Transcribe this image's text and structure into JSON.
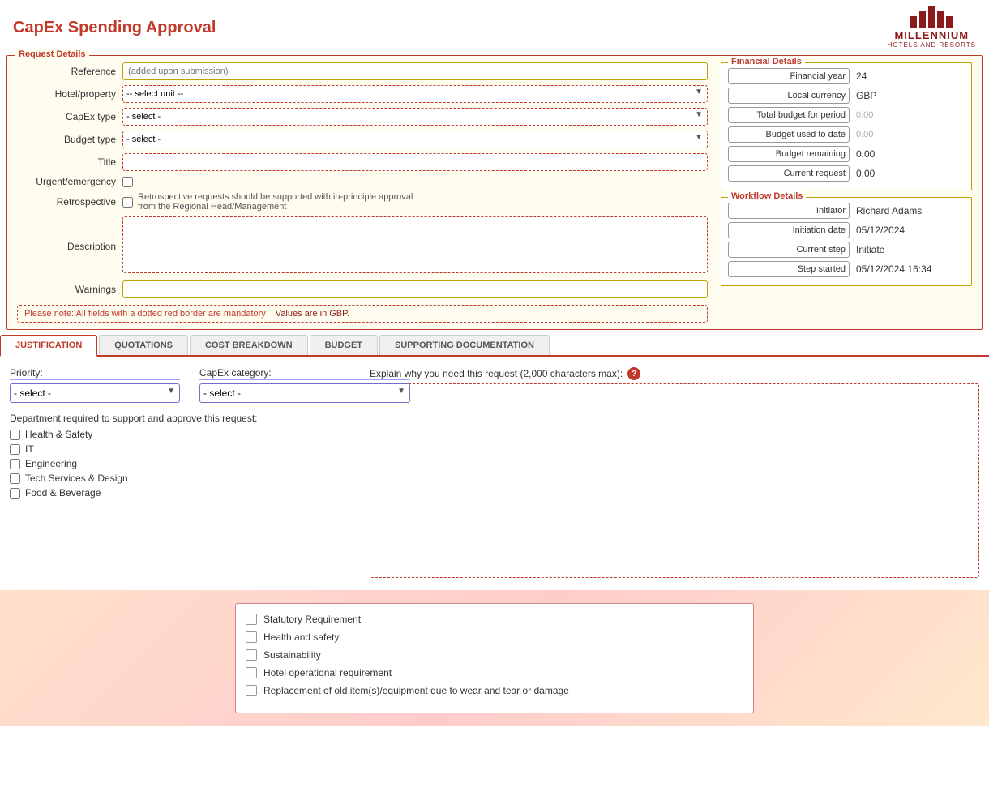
{
  "header": {
    "title": "CapEx Spending Approval",
    "logo_text": "MILLENNIUM",
    "logo_sub": "HOTELS AND RESORTS"
  },
  "request_details": {
    "legend": "Request Details",
    "reference_label": "Reference",
    "reference_placeholder": "(added upon submission)",
    "hotel_property_label": "Hotel/property",
    "hotel_property_placeholder": "-- select unit --",
    "capex_type_label": "CapEx type",
    "capex_type_placeholder": "- select -",
    "budget_type_label": "Budget type",
    "budget_type_placeholder": "- select -",
    "title_label": "Title",
    "urgent_label": "Urgent/emergency",
    "retrospective_label": "Retrospective",
    "retrospective_note": "Retrospective requests should be supported with in-principle approval from the Regional Head/Management",
    "description_label": "Description",
    "warnings_label": "Warnings",
    "notice_mandatory": "Please note: All fields with a dotted red border are mandatory",
    "notice_gbp": "Values are in GBP."
  },
  "financial_details": {
    "legend": "Financial Details",
    "financial_year_label": "Financial year",
    "financial_year_value": "24",
    "local_currency_label": "Local currency",
    "local_currency_value": "GBP",
    "total_budget_label": "Total budget for period",
    "total_budget_value": "",
    "total_budget_sub": "0.00",
    "budget_used_label": "Budget used to date",
    "budget_used_value": "",
    "budget_used_sub": "0.00",
    "budget_remaining_label": "Budget remaining",
    "budget_remaining_value": "0.00",
    "current_request_label": "Current request",
    "current_request_value": "0.00"
  },
  "workflow_details": {
    "legend": "Workflow Details",
    "initiator_label": "Initiator",
    "initiator_value": "Richard Adams",
    "initiation_date_label": "Initiation date",
    "initiation_date_value": "05/12/2024",
    "current_step_label": "Current step",
    "current_step_value": "Initiate",
    "step_started_label": "Step started",
    "step_started_value": "05/12/2024 16:34"
  },
  "tabs": [
    {
      "id": "justification",
      "label": "JUSTIFICATION",
      "active": true
    },
    {
      "id": "quotations",
      "label": "QUOTATIONS",
      "active": false
    },
    {
      "id": "cost_breakdown",
      "label": "COST BREAKDOWN",
      "active": false
    },
    {
      "id": "budget",
      "label": "BUDGET",
      "active": false
    },
    {
      "id": "supporting_documentation",
      "label": "SUPPORTING DOCUMENTATION",
      "active": false
    }
  ],
  "justification": {
    "priority_label": "Priority:",
    "priority_placeholder": "- select -",
    "capex_category_label": "CapEx category:",
    "capex_category_placeholder": "- select -",
    "dept_label": "Department required to support and approve this request:",
    "departments": [
      {
        "id": "health_safety",
        "label": "Health & Safety"
      },
      {
        "id": "it",
        "label": "IT"
      },
      {
        "id": "engineering",
        "label": "Engineering"
      },
      {
        "id": "tech_services",
        "label": "Tech Services & Design"
      },
      {
        "id": "food_beverage",
        "label": "Food & Beverage"
      }
    ],
    "explain_label": "Explain why you need this request (2,000 characters max):",
    "explain_help": "?"
  },
  "bottom_section": {
    "items": [
      {
        "id": "statutory",
        "label": "Statutory Requirement"
      },
      {
        "id": "health_safety",
        "label": "Health and safety"
      },
      {
        "id": "sustainability",
        "label": "Sustainability"
      },
      {
        "id": "hotel_operational",
        "label": "Hotel operational requirement"
      },
      {
        "id": "replacement",
        "label": "Replacement of old item(s)/equipment due to wear and tear or damage"
      }
    ]
  }
}
